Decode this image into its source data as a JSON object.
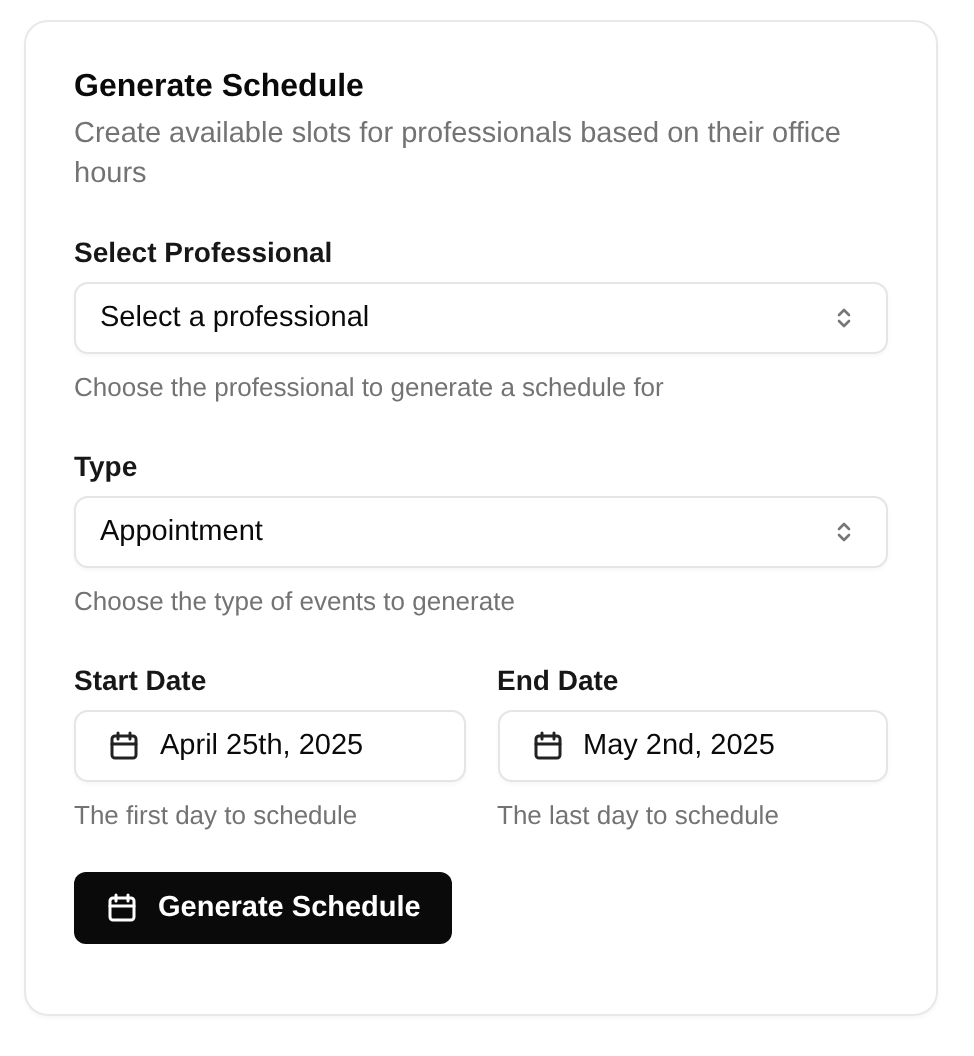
{
  "card": {
    "title": "Generate Schedule",
    "description": "Create available slots for professionals based on their office hours"
  },
  "selects": [
    {
      "label": "Select Professional",
      "value": "Select a professional",
      "help": "Choose the professional to generate a schedule for"
    },
    {
      "label": "Type",
      "value": "Appointment",
      "help": "Choose the type of events to generate"
    }
  ],
  "dates": [
    {
      "label": "Start Date",
      "value": "April 25th, 2025",
      "help": "The first day to schedule"
    },
    {
      "label": "End Date",
      "value": "May 2nd, 2025",
      "help": "The last day to schedule"
    }
  ],
  "submit": {
    "label": "Generate Schedule"
  }
}
